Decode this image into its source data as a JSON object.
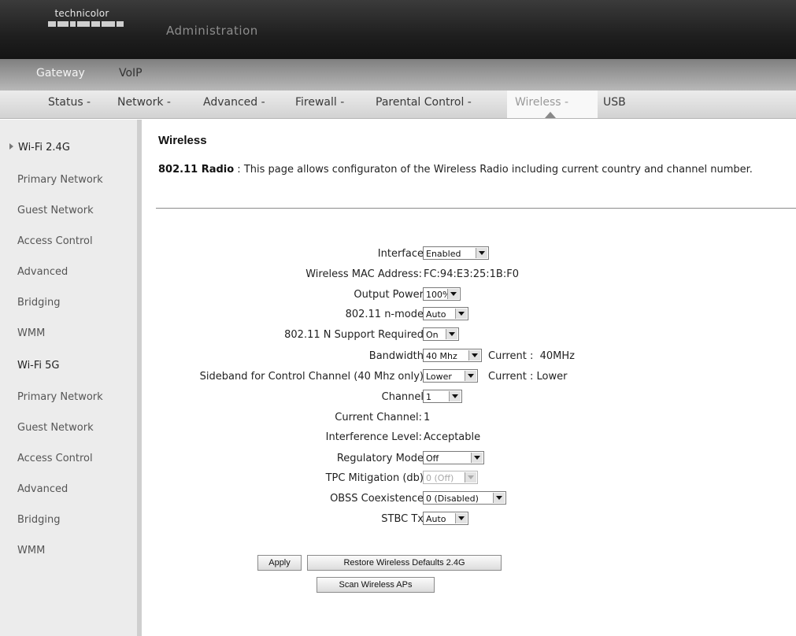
{
  "header": {
    "brand": "technicolor",
    "title": "Administration"
  },
  "nav_primary": {
    "gateway": "Gateway",
    "voip": "VoIP"
  },
  "nav_secondary": {
    "status": "Status -",
    "network": "Network -",
    "advanced": "Advanced -",
    "firewall": "Firewall -",
    "parental": "Parental Control -",
    "wireless": "Wireless -",
    "usb": "USB",
    "active": "Wireless"
  },
  "sidebar": {
    "wifi24": "Wi-Fi 2.4G",
    "items24": [
      "Primary Network",
      "Guest Network",
      "Access Control",
      "Advanced",
      "Bridging",
      "WMM"
    ],
    "wifi5": "Wi-Fi 5G",
    "items5": [
      "Primary Network",
      "Guest Network",
      "Access Control",
      "Advanced",
      "Bridging",
      "WMM"
    ]
  },
  "main": {
    "title": "Wireless",
    "desc_label": "802.11 Radio",
    "desc_sep": " : ",
    "desc_text": "This page allows configuraton of the Wireless Radio including current country and channel number."
  },
  "form": {
    "interface": {
      "label": "Interface",
      "value": "Enabled"
    },
    "mac": {
      "label": "Wireless MAC Address:",
      "value": "FC:94:E3:25:1B:F0"
    },
    "output_power": {
      "label": "Output Power",
      "value": "100%"
    },
    "nmode": {
      "label": "802.11 n-mode",
      "value": "Auto"
    },
    "n_required": {
      "label": "802.11 N Support Required",
      "value": "On"
    },
    "bandwidth": {
      "label": "Bandwidth",
      "value": "40 Mhz",
      "current": "Current :  40MHz"
    },
    "sideband": {
      "label": "Sideband for Control Channel (40 Mhz only)",
      "value": "Lower",
      "current": "Current : Lower"
    },
    "channel": {
      "label": "Channel",
      "value": "1"
    },
    "current_channel": {
      "label": "Current Channel:",
      "value": "1"
    },
    "interference": {
      "label": "Interference Level:",
      "value": "Acceptable"
    },
    "regulatory": {
      "label": "Regulatory Mode",
      "value": "Off"
    },
    "tpc": {
      "label": "TPC Mitigation (db)",
      "value": "0 (Off)"
    },
    "obss": {
      "label": "OBSS Coexistence",
      "value": "0 (Disabled)"
    },
    "stbc": {
      "label": "STBC Tx",
      "value": "Auto"
    }
  },
  "buttons": {
    "apply": "Apply",
    "restore": "Restore Wireless Defaults 2.4G",
    "scan": "Scan Wireless APs"
  }
}
